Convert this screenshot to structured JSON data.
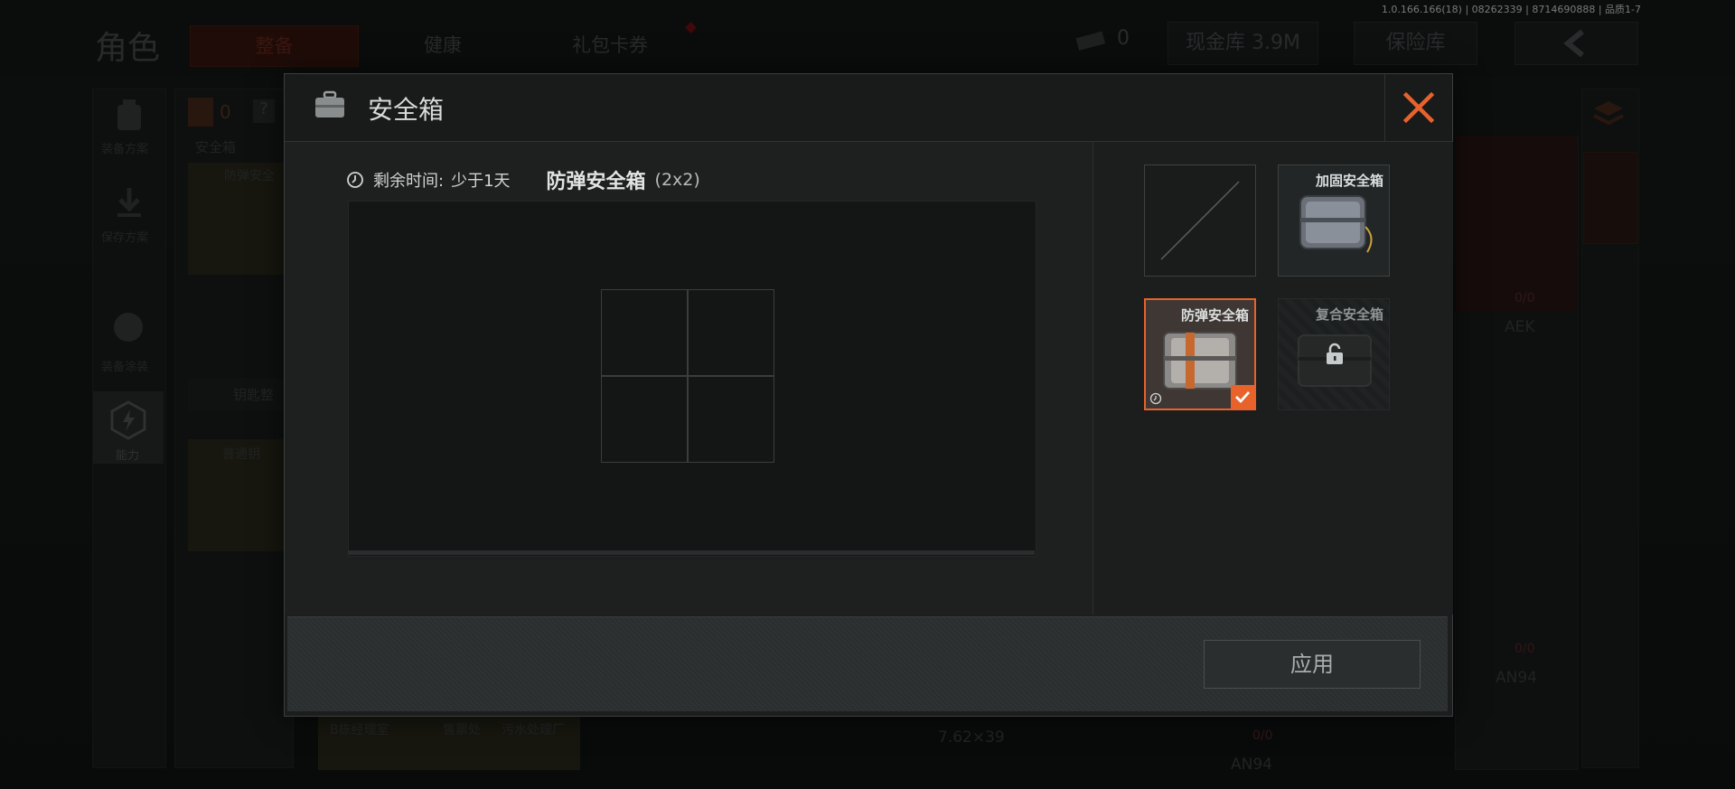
{
  "build_info": "1.0.166.166(18) | 08262339 | 8714690888 | 品质1-7",
  "background": {
    "page_title": "角色",
    "tabs": [
      {
        "label": "整备",
        "active": true
      },
      {
        "label": "健康",
        "active": false
      },
      {
        "label": "礼包卡券",
        "active": false
      }
    ],
    "currency_count": "0",
    "cash_storage": "现金库 3.9M",
    "vault_label": "保险库",
    "sidebar": [
      {
        "label": "装备方案",
        "icon": "backpack-icon"
      },
      {
        "label": "保存方案",
        "icon": "download-icon"
      },
      {
        "label": "装备涂装",
        "icon": "helmet-icon"
      },
      {
        "label": "能力",
        "icon": "ability-icon"
      }
    ],
    "armor_count": "0",
    "safe_box_label": "安全箱",
    "safe_box_item": "防弹安全",
    "key_section_label": "钥匙整",
    "key_item": "普通钥",
    "key_slots": [
      "B栋经理室",
      "售票处",
      "污水处理厂"
    ],
    "weapons": [
      {
        "name": "AEK",
        "ammo": "0/0"
      },
      {
        "name": "AN94",
        "ammo": "0/0"
      },
      {
        "name": "AN94",
        "ammo": "0/0"
      }
    ],
    "caliber": "7.62×39"
  },
  "modal": {
    "title": "安全箱",
    "remaining_label": "剩余时间:",
    "remaining_value": "少于1天",
    "case_name": "防弹安全箱",
    "case_size": "(2x2)",
    "grid": {
      "rows": 2,
      "cols": 2
    },
    "options": [
      {
        "label": "",
        "state": "empty"
      },
      {
        "label": "加固安全箱",
        "state": "available"
      },
      {
        "label": "防弹安全箱",
        "state": "selected"
      },
      {
        "label": "复合安全箱",
        "state": "locked"
      }
    ],
    "apply_label": "应用"
  },
  "colors": {
    "accent": "#e8622c",
    "close": "#e8622c"
  }
}
